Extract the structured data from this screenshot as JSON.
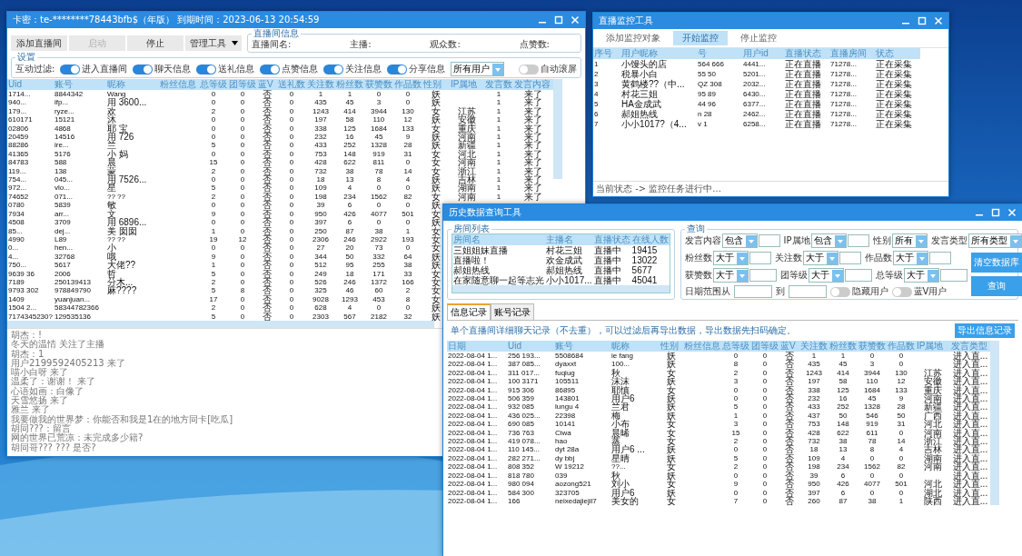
{
  "main_window": {
    "title": "卡密：te-********78443bfb$（年版） 到期时间：2023-06-13 20:54:59",
    "toolbar": [
      {
        "label": "添加直播间",
        "kind": "button",
        "disabled": false
      },
      {
        "label": "启动",
        "kind": "button",
        "disabled": true
      },
      {
        "label": "停止",
        "kind": "button",
        "disabled": false
      },
      {
        "label": "管理工具",
        "kind": "menu",
        "disabled": false
      }
    ],
    "room_info": {
      "legend": "直播间信息",
      "fields": [
        "直播间名:",
        "主播:",
        "观众数:",
        "点赞数:"
      ]
    },
    "settings": {
      "legend": "设置",
      "filter_label": "互动过滤:",
      "filters": [
        {
          "label": "进入直播间",
          "on": true
        },
        {
          "label": "聊天信息",
          "on": true
        },
        {
          "label": "送礼信息",
          "on": true
        },
        {
          "label": "点赞信息",
          "on": true
        },
        {
          "label": "关注信息",
          "on": true
        },
        {
          "label": "分享信息",
          "on": true
        }
      ],
      "user_filter": "所有用户",
      "auto_scroll": {
        "label": "自动滚屏",
        "on": false
      }
    },
    "table": {
      "columns": [
        "Uid",
        "账号",
        "昵称",
        "粉丝信息",
        "总等级",
        "团等级",
        "蓝V",
        "送礼数",
        "关注数",
        "粉丝数",
        "获赞数",
        "作品数",
        "性别",
        "IP属地",
        "发言数",
        "发言内容"
      ],
      "rows": [
        [
          "1714...",
          "8844342",
          "Wang",
          "",
          "0",
          "0",
          "否",
          "0",
          "1",
          "1",
          "0",
          "0",
          "妖",
          null,
          "1",
          "来了"
        ],
        [
          "940...",
          "ifp...",
          "用 3600...",
          "",
          "0",
          "0",
          "否",
          "0",
          "435",
          "45",
          "3",
          "0",
          "妖",
          null,
          "1",
          "来了"
        ],
        [
          "179...",
          "ryze...",
          "欢",
          "",
          "2",
          "0",
          "否",
          "0",
          "1243",
          "414",
          "3944",
          "130",
          "女",
          "江苏",
          "1",
          "来了"
        ],
        [
          "610171",
          "15121",
          "沐",
          "",
          "0",
          "0",
          "否",
          "0",
          "197",
          "58",
          "110",
          "12",
          "妖",
          "安徽",
          "1",
          "来了"
        ],
        [
          "02806",
          "4868",
          "耶 宝",
          "",
          "0",
          "0",
          "否",
          "0",
          "338",
          "125",
          "1684",
          "133",
          "女",
          "重庆",
          "1",
          "来了"
        ],
        [
          "20459",
          "14516",
          "用 726",
          "",
          "0",
          "0",
          "否",
          "0",
          "232",
          "16",
          "45",
          "9",
          "妖",
          "河南",
          "1",
          "来了"
        ],
        [
          "88286",
          "ire...",
          "兰",
          "",
          "5",
          "0",
          "否",
          "0",
          "433",
          "252",
          "1328",
          "28",
          "妖",
          "新疆",
          "1",
          "来了"
        ],
        [
          "41365",
          "5176",
          "小 妈",
          "",
          "0",
          "0",
          "否",
          "0",
          "753",
          "148",
          "919",
          "31",
          "女",
          "河北",
          "1",
          "来了"
        ],
        [
          "84783",
          "588",
          "晨",
          "",
          "15",
          "0",
          "否",
          "0",
          "428",
          "622",
          "811",
          "0",
          "女",
          "河南",
          "1",
          "来了"
        ],
        [
          "119...",
          "138",
          "蒙",
          "",
          "2",
          "0",
          "否",
          "0",
          "732",
          "38",
          "78",
          "14",
          "女",
          "浙江",
          "1",
          "来了"
        ],
        [
          "754...",
          "045...",
          "用 7526...",
          "",
          "0",
          "0",
          "否",
          "0",
          "18",
          "13",
          "8",
          "4",
          "妖",
          "吉林",
          "1",
          "来了"
        ],
        [
          "972...",
          "vlo...",
          "星",
          "",
          "5",
          "0",
          "否",
          "0",
          "109",
          "4",
          "0",
          "0",
          "妖",
          "湖南",
          "1",
          "来了"
        ],
        [
          "74652",
          "071...",
          "?? ??",
          "",
          "2",
          "0",
          "否",
          "0",
          "198",
          "234",
          "1562",
          "82",
          "女",
          "河南",
          "1",
          "来了"
        ],
        [
          "0780",
          "5839",
          "敏",
          "",
          "0",
          "0",
          "否",
          "0",
          "39",
          "6",
          "0",
          "0",
          "妖"
        ],
        [
          "7934",
          "arr...",
          "文",
          "",
          "9",
          "0",
          "否",
          "0",
          "950",
          "426",
          "4077",
          "501",
          "女"
        ],
        [
          "4508",
          "3709",
          "用 6896...",
          "",
          "0",
          "0",
          "否",
          "0",
          "397",
          "6",
          "0",
          "0",
          "妖"
        ],
        [
          "85...",
          "dej...",
          "美 囡囡",
          "",
          "1",
          "0",
          "否",
          "0",
          "250",
          "87",
          "38",
          "1",
          "女"
        ],
        [
          "4990",
          "L89",
          "?? ??",
          "",
          "19",
          "12",
          "否",
          "0",
          "2306",
          "246",
          "2922",
          "193",
          "女"
        ],
        [
          "0...",
          "hen...",
          "小",
          "",
          "0",
          "0",
          "否",
          "0",
          "27",
          "20",
          "73",
          "0",
          "女"
        ],
        [
          "4...",
          "32768",
          "哦",
          "",
          "9",
          "0",
          "否",
          "0",
          "344",
          "50",
          "332",
          "64",
          "妖"
        ],
        [
          "750...",
          "5617",
          "大佬??",
          "",
          "1",
          "0",
          "否",
          "0",
          "512",
          "95",
          "255",
          "38",
          "妖"
        ],
        [
          "9639 36",
          "2006",
          "哲",
          "",
          "5",
          "0",
          "否",
          "0",
          "249",
          "18",
          "171",
          "33",
          "女"
        ],
        [
          "7189",
          "250139413",
          "分木...",
          "",
          "2",
          "0",
          "否",
          "0",
          "526",
          "246",
          "1372",
          "166",
          "女"
        ],
        [
          "9793 302",
          "978849790",
          "麻????",
          "",
          "5",
          "8",
          "否",
          "0",
          "325",
          "46",
          "60",
          "2",
          "女"
        ],
        [
          "1409",
          "yuanjuan...",
          "",
          "",
          "17",
          "0",
          "否",
          "0",
          "9028",
          "1293",
          "453",
          "8",
          "女"
        ],
        [
          "1504 2...",
          "58344782366",
          "",
          "",
          "2",
          "0",
          "否",
          "0",
          "628",
          "4",
          "0",
          "0",
          "妖"
        ],
        [
          "7174345230?",
          "129535136",
          "",
          "",
          "5",
          "0",
          "否",
          "0",
          "2303",
          "567",
          "2182",
          "32",
          "妖"
        ]
      ]
    },
    "log": [
      "胡杰：!",
      "冬天的温情 关注了主播",
      "胡杰：1",
      "用户2199592405213 来了",
      "喵小白呀 来了",
      "温柔了：谢谢！ 来了",
      "心语如画：白像了",
      "天雪悠扬 来了",
      "雅兰 来了",
      "我要做我的世界梦：你能否和我是1在的地方同卡[吃瓜]",
      "胡同???：留言",
      "网的世界已荒凉：未完成多少籍?",
      "胡同哥??? ??? 是否?"
    ]
  },
  "monitor_window": {
    "title": "直播监控工具",
    "tabs": [
      {
        "label": "添加监控对象",
        "selected": false
      },
      {
        "label": "开始监控",
        "selected": true
      },
      {
        "label": "停止监控",
        "selected": false
      }
    ],
    "table": {
      "columns": [
        "序号",
        "用户昵称",
        "号",
        "用户id",
        "直播状态",
        "直播房间",
        "状态"
      ],
      "rows": [
        [
          "1",
          "小馒头的店",
          "564  666",
          "4441...",
          "正在直播",
          "71278...",
          "正在采集"
        ],
        [
          "2",
          "税暴小白",
          "55  50",
          "5201...",
          "正在直播",
          "71278...",
          "正在采集"
        ],
        [
          "3",
          "黄鹤楼??（中...",
          "QZ  308",
          "2032...",
          "正在直播",
          "71278...",
          "正在采集"
        ],
        [
          "4",
          "村花三姐",
          "95  89",
          "6430...",
          "正在直播",
          "71278...",
          "正在采集"
        ],
        [
          "5",
          "HA金成武",
          "44  96",
          "6377...",
          "正在直播",
          "71278...",
          "正在采集"
        ],
        [
          "6",
          "郝姐热线",
          "n  28",
          "2462...",
          "正在直播",
          "71278...",
          "正在采集"
        ],
        [
          "7",
          "小小1017?（4...",
          "v  1",
          "6258...",
          "正在直播",
          "71278...",
          "正在采集"
        ]
      ]
    },
    "status": "当前状态 -> 监控任务进行中..."
  },
  "history_window": {
    "title": "历史数据查询工具",
    "room_list": {
      "legend": "房间列表",
      "columns": [
        "房间名",
        "主播名",
        "直播状态",
        "在线人数"
      ],
      "rows": [
        [
          "三姐姐妹直播",
          "村花三姐",
          "直播中",
          "19415"
        ],
        [
          "直播啦！",
          "欢金成武",
          "直播中",
          "13022"
        ],
        [
          "郝姐热线",
          "郝姐热线",
          "直播中",
          "5677"
        ],
        [
          "在家随意聊一起等志光",
          "小小1017...",
          "直播中",
          "45041"
        ]
      ]
    },
    "query": {
      "legend": "查询",
      "rows": [
        [
          {
            "kind": "text",
            "label": "发言内容",
            "operator": "包含"
          },
          {
            "kind": "text",
            "label": "IP属地",
            "operator": "包含"
          },
          {
            "kind": "select",
            "label": "性别",
            "value": "所有"
          },
          {
            "kind": "select",
            "label": "发言类型",
            "value": "所有类型"
          }
        ],
        [
          {
            "kind": "text",
            "label": "粉丝数",
            "operator": "大于"
          },
          {
            "kind": "text",
            "label": "关注数",
            "operator": "大于"
          },
          {
            "kind": "text",
            "label": "作品数",
            "operator": "大于"
          }
        ],
        [
          {
            "kind": "text",
            "label": "获赞数",
            "operator": "大于"
          },
          {
            "kind": "text",
            "label": "团等级",
            "operator": "大于"
          },
          {
            "kind": "text",
            "label": "总等级",
            "operator": "大于"
          }
        ]
      ],
      "date_from": "日期范围从",
      "date_to": "到",
      "toggles": [
        {
          "label": "隐藏用户",
          "on": false
        },
        {
          "label": "蓝V用户",
          "on": false
        }
      ],
      "buttons": [
        "清空数据库",
        "查询"
      ]
    },
    "tabs": [
      {
        "label": "信息记录",
        "selected": true
      },
      {
        "label": "账号记录",
        "selected": false
      }
    ],
    "note": "单个直播间详细聊天记录（不去重），可以过滤后再导出数据，导出数据先扫码确定。",
    "export_button": "导出信息记录",
    "table": {
      "columns": [
        "日期",
        "Uid",
        "账号",
        "昵称",
        "性别",
        "粉丝信息",
        "总等级",
        "团等级",
        "蓝V",
        "关注数",
        "粉丝数",
        "获赞数",
        "作品数",
        "IP属地",
        "发言类型"
      ],
      "rows": [
        [
          "2022-08-04 1...",
          "256 193...",
          "5508684",
          "ie fang",
          "妖",
          "",
          "0",
          "0",
          "否",
          "1",
          "1",
          "0",
          "0",
          null,
          "进入直..."
        ],
        [
          "2022-08-04 1...",
          "387 085...",
          "dyaxxt",
          "100...",
          "妖",
          "",
          "8",
          "0",
          "否",
          "435",
          "45",
          "3",
          "0",
          null,
          "进入直..."
        ],
        [
          "2022-08-04 1...",
          "311 017...",
          "fuqiug",
          "秋",
          "女",
          "",
          "2",
          "0",
          "否",
          "1243",
          "414",
          "3944",
          "130",
          "江苏",
          "进入直..."
        ],
        [
          "2022-08-04 1...",
          "100 3171",
          "105511",
          "沫沫",
          "妖",
          "",
          "3",
          "0",
          "否",
          "197",
          "58",
          "110",
          "12",
          "安徽",
          "进入直..."
        ],
        [
          "2022-08-04 1...",
          "915 306",
          "86895",
          "耶慎",
          "女",
          "",
          "0",
          "0",
          "否",
          "338",
          "125",
          "1684",
          "133",
          "重庆",
          "进入直..."
        ],
        [
          "2022-08-04 1...",
          "506 359",
          "143801",
          "用户6",
          "妖",
          "",
          "0",
          "0",
          "否",
          "232",
          "16",
          "45",
          "9",
          "河南",
          "进入直..."
        ],
        [
          "2022-08-04 1...",
          "932 085",
          "lungu 4",
          "兰君",
          "妖",
          "",
          "5",
          "0",
          "否",
          "433",
          "252",
          "1328",
          "28",
          "新疆",
          "进入直..."
        ],
        [
          "2022-08-04 1...",
          "436 025...",
          "22398",
          "梅",
          "妖",
          "",
          "1",
          "0",
          "否",
          "437",
          "50",
          "546",
          "50",
          "广西",
          "进入直..."
        ],
        [
          "2022-08-04 1...",
          "690 085",
          "10141",
          "小布",
          "女",
          "",
          "3",
          "0",
          "否",
          "753",
          "148",
          "919",
          "31",
          "河北",
          "进入直..."
        ],
        [
          "2022-08-04 1...",
          "736 763",
          "Ciwa",
          "晨晞",
          "女",
          "",
          "15",
          "0",
          "否",
          "428",
          "622",
          "611",
          "0",
          "河南",
          "进入直..."
        ],
        [
          "2022-08-04 1...",
          "419 078...",
          "hao",
          "蒸",
          "女",
          "",
          "2",
          "0",
          "否",
          "732",
          "38",
          "78",
          "14",
          "浙江",
          "进入直..."
        ],
        [
          "2022-08-04 1...",
          "110 145...",
          "dyt 28a",
          "用户6 ...",
          "妖",
          "",
          "0",
          "0",
          "否",
          "18",
          "13",
          "8",
          "4",
          "吉林",
          "进入直..."
        ],
        [
          "2022-08-04 1...",
          "282 271...",
          "dy bbj",
          "星晴",
          "妖",
          "",
          "5",
          "0",
          "否",
          "109",
          "4",
          "0",
          "0",
          "湖南",
          "进入直..."
        ],
        [
          "2022-08-04 1...",
          "808 352",
          "W 19212",
          "??...",
          "女",
          "",
          "2",
          "0",
          "否",
          "198",
          "234",
          "1562",
          "82",
          "河南",
          "进入直..."
        ],
        [
          "2022-08-04 1...",
          "818 780",
          "039",
          "秋",
          "妖",
          "",
          "0",
          "0",
          "否",
          "39",
          "6",
          "0",
          "0",
          null,
          "进入直..."
        ],
        [
          "2022-08-04 1...",
          "980 094",
          "aozong521",
          "刘小",
          "女",
          "",
          "9",
          "0",
          "否",
          "950",
          "426",
          "4077",
          "501",
          "河北",
          "进入直..."
        ],
        [
          "2022-08-04 1...",
          "584 300",
          "323705",
          "用户6",
          "妖",
          "",
          "0",
          "0",
          "否",
          "397",
          "6",
          "0",
          "0",
          "湖北",
          "进入直..."
        ],
        [
          "2022-08-04 1...",
          "166",
          "neixedajiejil7",
          "美女的",
          "女",
          "",
          "7",
          "0",
          "否",
          "260",
          "87",
          "38",
          "1",
          "陕西",
          "进入直..."
        ]
      ]
    }
  }
}
